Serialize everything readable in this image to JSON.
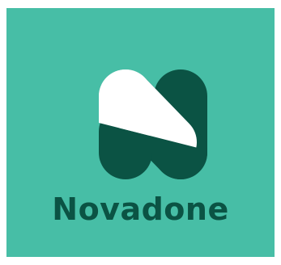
{
  "brand": {
    "name": "Novadone",
    "colors": {
      "background": "#47bea6",
      "dark": "#0b5344",
      "light": "#ffffff"
    },
    "logo_icon": "letter-n-logo-icon"
  }
}
